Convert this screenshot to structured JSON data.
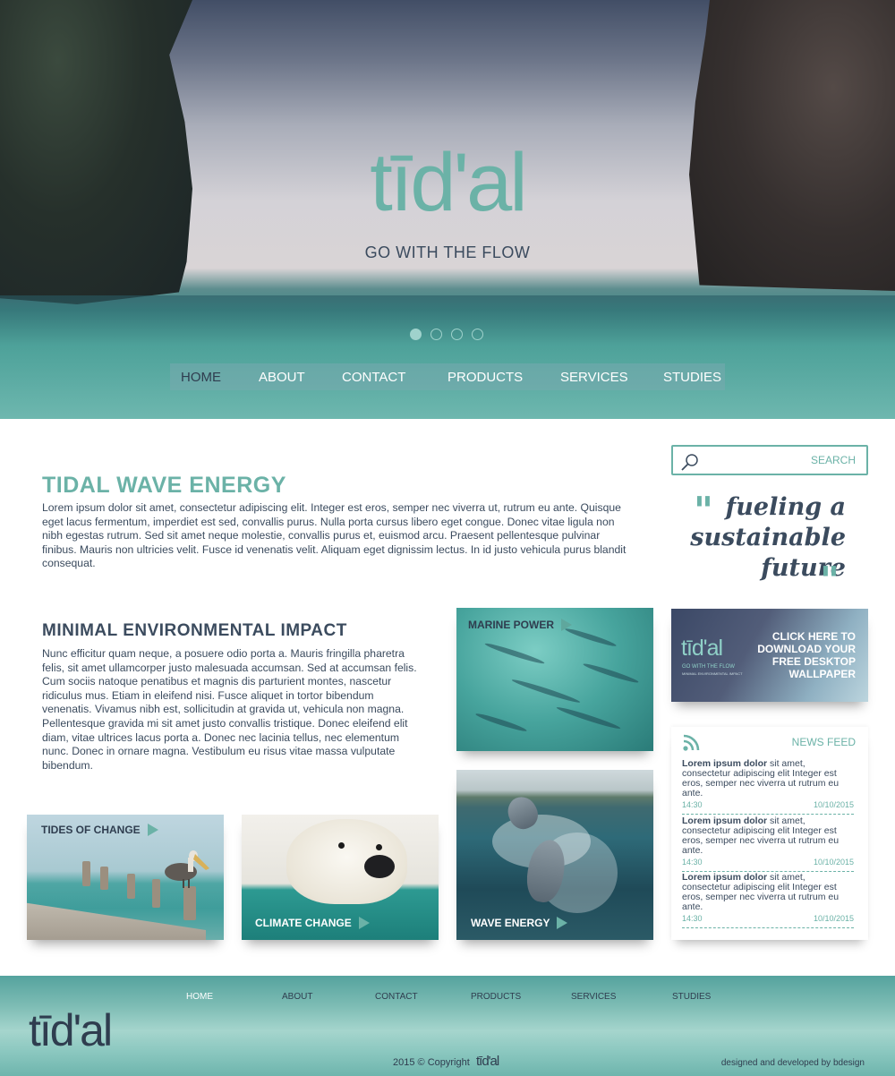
{
  "hero": {
    "logo": "tīd'al",
    "tagline": "GO WITH THE FLOW",
    "slide_count": 4,
    "active_slide": 1
  },
  "nav": {
    "items": [
      "HOME",
      "ABOUT",
      "CONTACT",
      "PRODUCTS",
      "SERVICES",
      "STUDIES"
    ],
    "active": "HOME"
  },
  "main": {
    "section1": {
      "heading": "TIDAL WAVE ENERGY",
      "body": "Lorem ipsum dolor sit amet, consectetur adipiscing elit. Integer est eros, semper nec viverra ut, rutrum eu ante. Quisque eget lacus fermentum, imperdiet est sed, convallis purus. Nulla porta cursus libero eget congue. Donec vitae ligula non nibh egestas rutrum. Sed sit amet neque molestie, convallis purus et, euismod arcu. Praesent pellentesque pulvinar finibus. Mauris non ultricies velit. Fusce id venenatis velit. Aliquam eget dignissim lectus. In id justo vehicula purus blandit consequat."
    },
    "section2": {
      "heading": "MINIMAL ENVIRONMENTAL IMPACT",
      "body": "Nunc efficitur quam neque, a posuere odio porta a. Mauris fringilla pharetra felis, sit amet ullamcorper justo malesuada accumsan. Sed at accumsan felis. Cum sociis natoque penatibus et magnis dis parturient montes, nascetur ridiculus mus. Etiam in eleifend nisi. Fusce aliquet in tortor bibendum venenatis. Vivamus nibh est, sollicitudin at gravida ut, vehicula non magna. Pellentesque gravida mi sit amet justo convallis tristique. Donec eleifend elit diam, vitae ultrices lacus porta a. Donec nec lacinia tellus, nec elementum nunc. Donec in ornare magna. Vestibulum eu risus vitae massa vulputate bibendum."
    }
  },
  "sidebar": {
    "search": {
      "placeholder": "",
      "button_label": "SEARCH"
    },
    "quote": {
      "line1": "fueling a",
      "line2": "sustainable",
      "line3": "future",
      "open_mark": "\"",
      "close_mark": "\""
    },
    "wallpaper": {
      "logo": "tīd'al",
      "sub1": "GO WITH THE FLOW",
      "sub2": "MINIMAL ENVIRONMENTAL IMPACT",
      "cta": "CLICK HERE TO DOWNLOAD YOUR FREE DESKTOP WALLPAPER"
    },
    "news": {
      "title": "NEWS FEED",
      "items": [
        {
          "lead": "Lorem ipsum dolor",
          "text": " sit amet, consectetur adipiscing elit Integer est eros, semper nec viverra ut rutrum eu ante.",
          "time": "14:30",
          "date": "10/10/2015"
        },
        {
          "lead": "Lorem ipsum dolor",
          "text": " sit amet, consectetur adipiscing elit Integer est eros, semper nec viverra ut rutrum eu ante.",
          "time": "14:30",
          "date": "10/10/2015"
        },
        {
          "lead": "Lorem ipsum dolor",
          "text": " sit amet, consectetur adipiscing elit Integer est eros, semper nec viverra ut rutrum eu ante.",
          "time": "14:30",
          "date": "10/10/2015"
        }
      ]
    }
  },
  "cards": {
    "marine": "MARINE POWER",
    "wave": "WAVE ENERGY",
    "tides": "TIDES OF CHANGE",
    "climate": "CLIMATE CHANGE"
  },
  "footer": {
    "nav": [
      "HOME",
      "ABOUT",
      "CONTACT",
      "PRODUCTS",
      "SERVICES",
      "STUDIES"
    ],
    "active": "HOME",
    "logo": "tīd'al",
    "copyright": "2015 © Copyright",
    "copyright_logo": "tīd'al",
    "credit": "designed and developed by bdesign"
  },
  "colors": {
    "accent": "#6bb2a7",
    "text": "#3b4b5e",
    "footer_bg": "#7dbcb4"
  }
}
